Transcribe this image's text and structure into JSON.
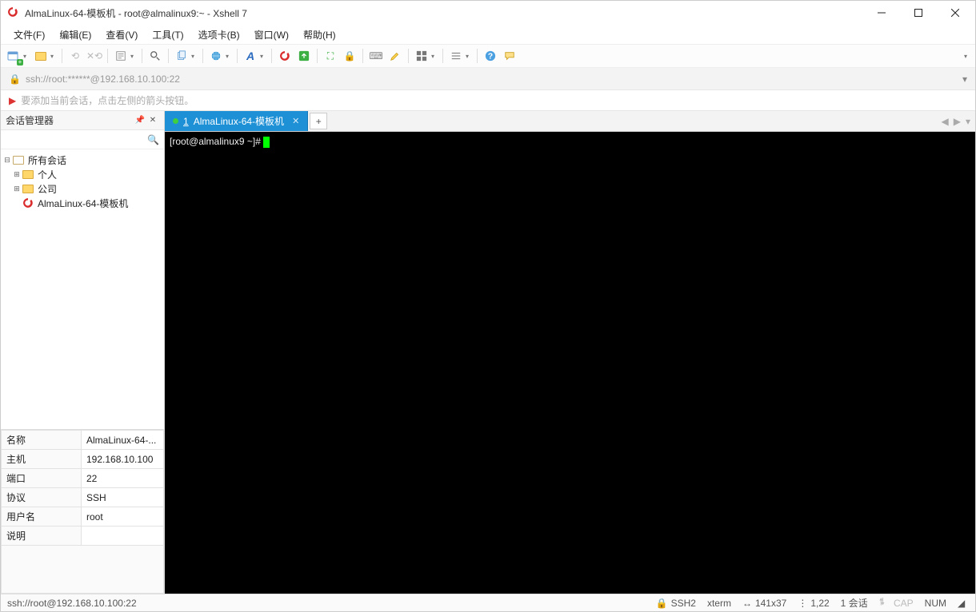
{
  "title": "AlmaLinux-64-模板机 - root@almalinux9:~ - Xshell 7",
  "menu": {
    "file": "文件(F)",
    "edit": "编辑(E)",
    "view": "查看(V)",
    "tools": "工具(T)",
    "tabs": "选项卡(B)",
    "window": "窗口(W)",
    "help": "帮助(H)"
  },
  "address": "ssh://root:******@192.168.10.100:22",
  "hint": "要添加当前会话，点击左侧的箭头按钮。",
  "sidebar": {
    "title": "会话管理器",
    "root": "所有会话",
    "items": {
      "personal": "个人",
      "company": "公司",
      "session": "AlmaLinux-64-模板机"
    }
  },
  "props": {
    "name_k": "名称",
    "name_v": "AlmaLinux-64-...",
    "host_k": "主机",
    "host_v": "192.168.10.100",
    "port_k": "端口",
    "port_v": "22",
    "proto_k": "协议",
    "proto_v": "SSH",
    "user_k": "用户名",
    "user_v": "root",
    "desc_k": "说明",
    "desc_v": ""
  },
  "tab": {
    "num": "1",
    "label": "AlmaLinux-64-模板机"
  },
  "terminal": {
    "prompt": "[root@almalinux9 ~]# "
  },
  "status": {
    "path": "ssh://root@192.168.10.100:22",
    "proto": "SSH2",
    "term": "xterm",
    "size": "141x37",
    "pos": "1,22",
    "sessions": "1 会话",
    "cap": "CAP",
    "num": "NUM"
  }
}
